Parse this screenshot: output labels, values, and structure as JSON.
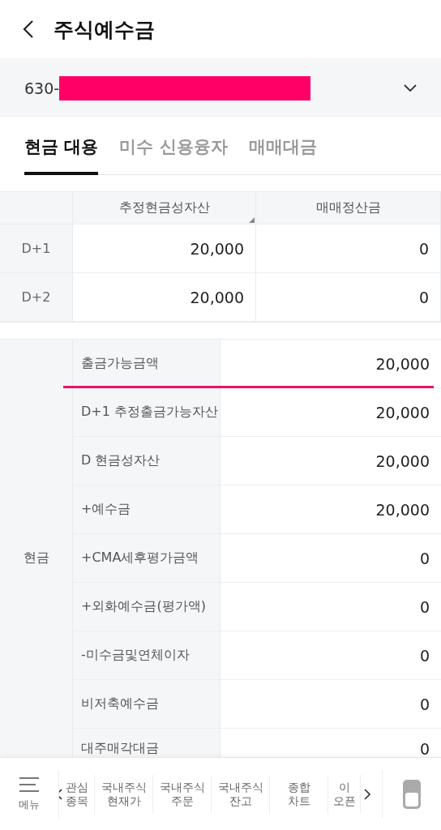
{
  "header": {
    "title": "주식예수금"
  },
  "account": {
    "prefix": "630-",
    "redacted": true
  },
  "tabs": [
    {
      "label": "현금 대용",
      "selected": true
    },
    {
      "label": "미수 신용융자",
      "selected": false
    },
    {
      "label": "매매대금",
      "selected": false
    }
  ],
  "settlement_table": {
    "columns": [
      "추정현금성자산",
      "매매정산금"
    ],
    "rows": [
      {
        "label": "D+1",
        "values": [
          "20,000",
          "0"
        ]
      },
      {
        "label": "D+2",
        "values": [
          "20,000",
          "0"
        ]
      }
    ]
  },
  "cash_table": {
    "group_label": "현금",
    "rows": [
      {
        "label": "출금가능금액",
        "value": "20,000",
        "highlighted": true
      },
      {
        "label": "D+1 추정출금가능자산",
        "value": "20,000",
        "highlighted": false
      },
      {
        "label": "D 현금성자산",
        "value": "20,000",
        "highlighted": false
      },
      {
        "label": "+예수금",
        "value": "20,000",
        "highlighted": false
      },
      {
        "label": "+CMA세후평가금액",
        "value": "0",
        "highlighted": false
      },
      {
        "label": "+외화예수금(평가액)",
        "value": "0",
        "highlighted": false
      },
      {
        "label": "-미수금및연체이자",
        "value": "0",
        "highlighted": false
      },
      {
        "label": "비저축예수금",
        "value": "0",
        "highlighted": false
      },
      {
        "label": "대주매각대금",
        "value": "0",
        "highlighted": false
      }
    ]
  },
  "bottom_nav": {
    "menu_label": "메뉴",
    "items": [
      {
        "lines": [
          "관심",
          "종목"
        ]
      },
      {
        "lines": [
          "국내주식",
          "현재가"
        ]
      },
      {
        "lines": [
          "국내주식",
          "주문"
        ]
      },
      {
        "lines": [
          "국내주식",
          "잔고"
        ]
      },
      {
        "lines": [
          "종합",
          "차트"
        ]
      },
      {
        "lines": [
          "이",
          "오픈"
        ]
      }
    ]
  }
}
